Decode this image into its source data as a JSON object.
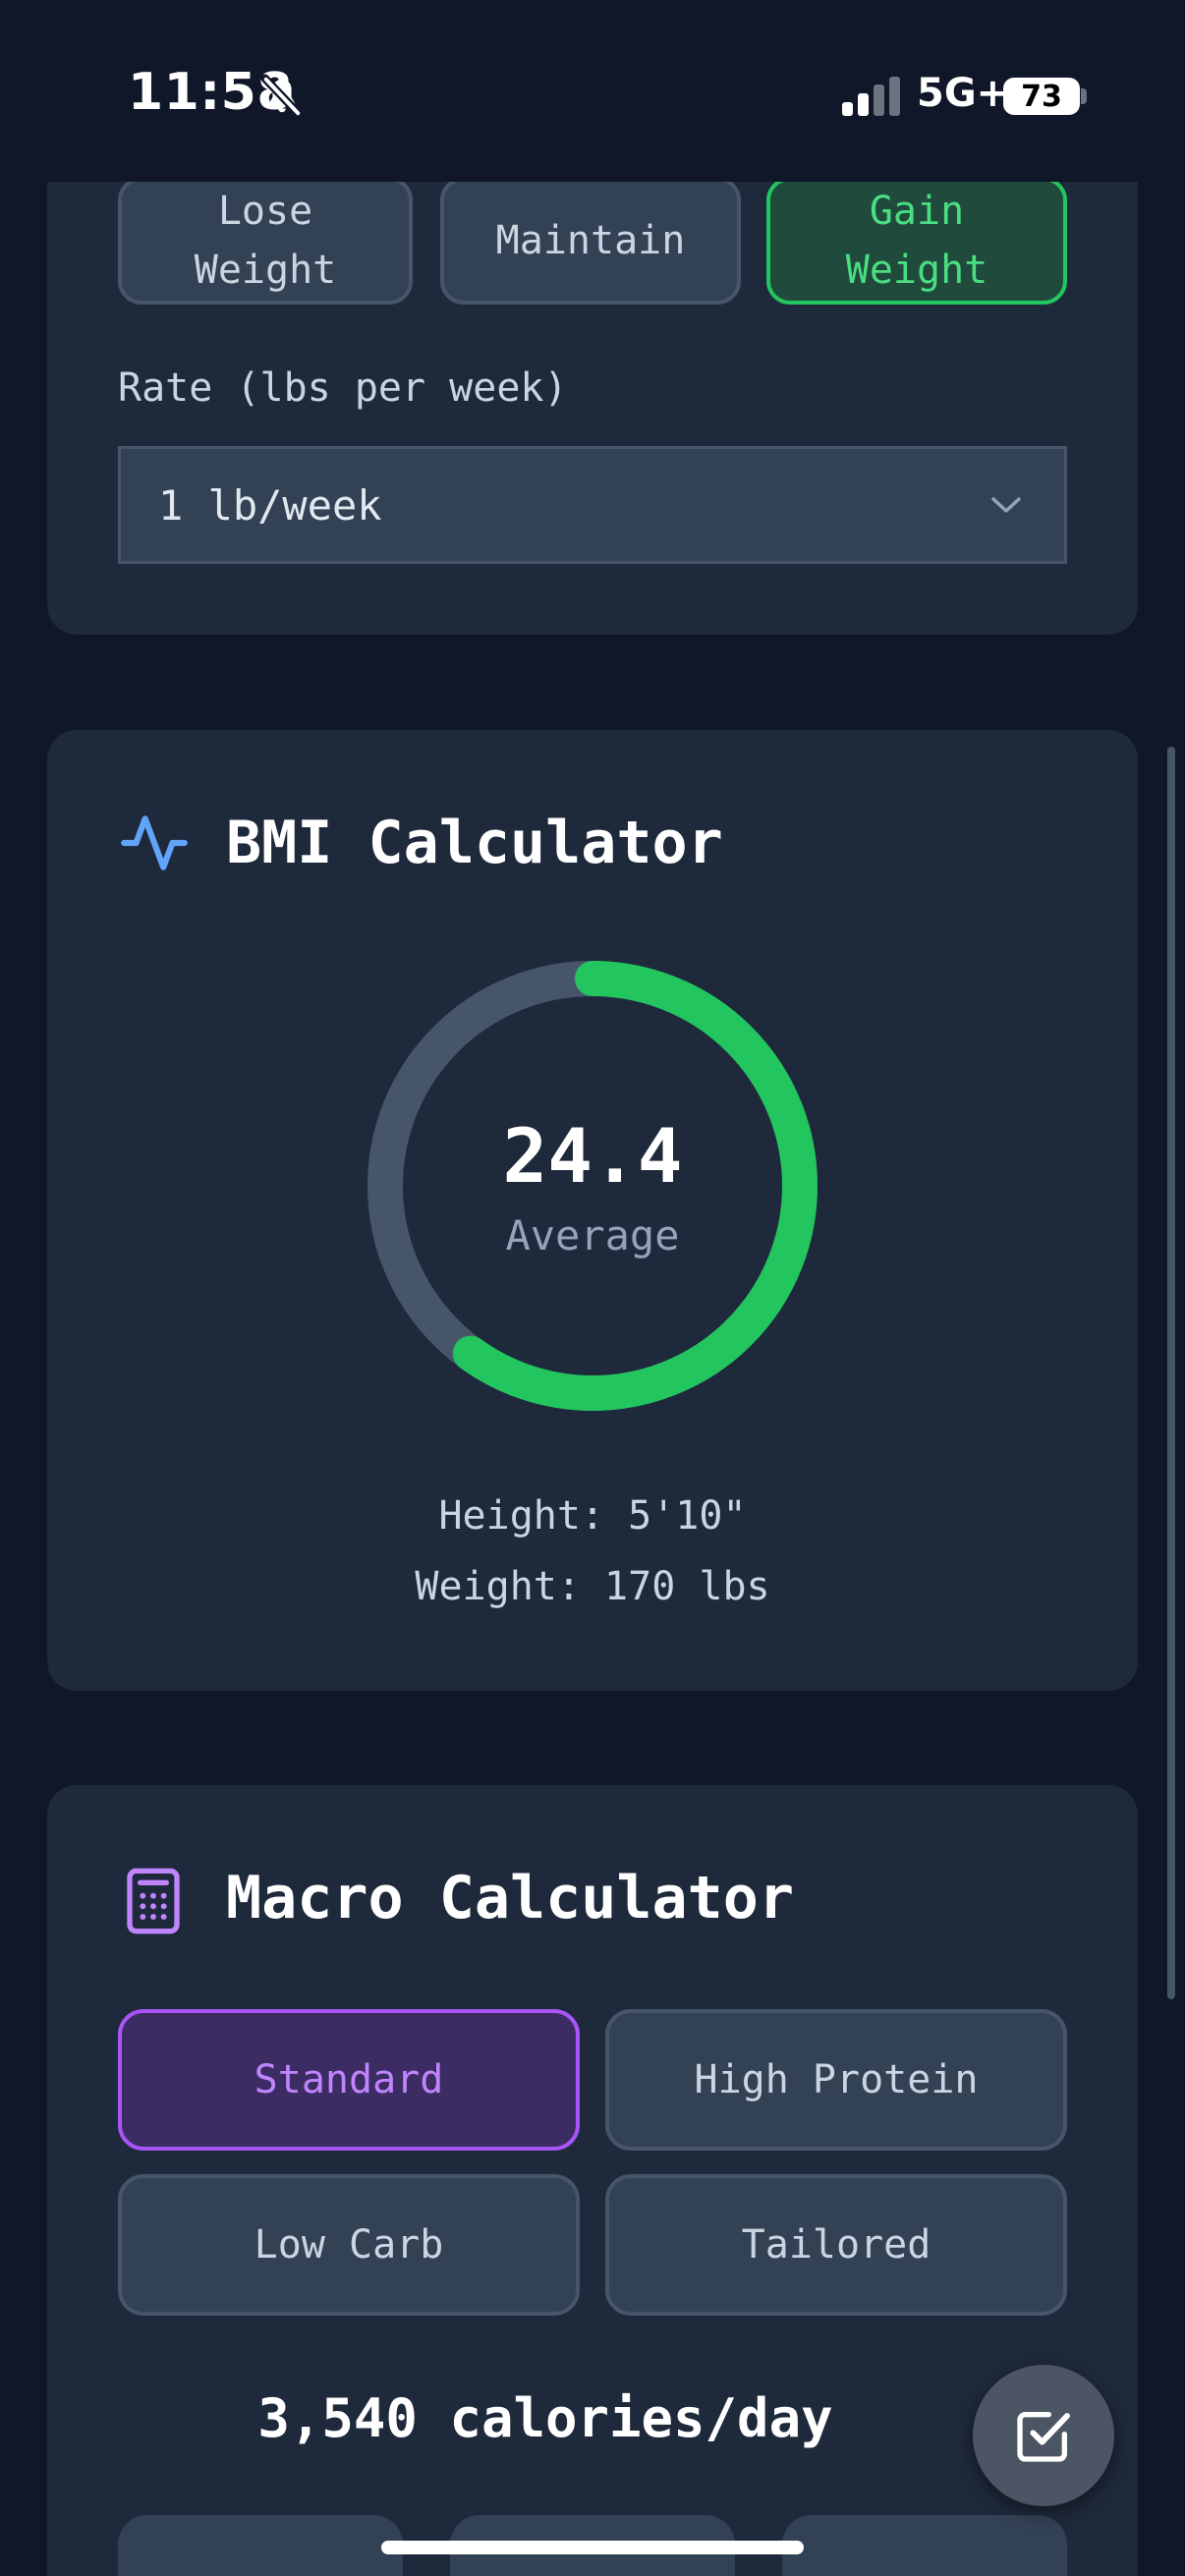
{
  "status_bar": {
    "time": "11:58",
    "network": "5G+",
    "battery": "73"
  },
  "goal": {
    "options": [
      {
        "label": "Lose\nWeight",
        "active": false
      },
      {
        "label": "Maintain",
        "active": false
      },
      {
        "label": "Gain\nWeight",
        "active": true
      }
    ],
    "rate_label": "Rate (lbs per week)",
    "rate_value": "1 lb/week"
  },
  "bmi": {
    "title": "BMI Calculator",
    "icon": "activity-icon",
    "value": "24.4",
    "category": "Average",
    "ring_fraction": 0.6,
    "height_text": "Height: 5'10\"",
    "weight_text": "Weight: 170 lbs"
  },
  "macro": {
    "title": "Macro Calculator",
    "icon": "calculator-icon",
    "presets": [
      {
        "label": "Standard",
        "active": true
      },
      {
        "label": "High Protein",
        "active": false
      },
      {
        "label": "Low Carb",
        "active": false
      },
      {
        "label": "Tailored",
        "active": false
      }
    ],
    "calories": "3,540 calories/day"
  },
  "fab": {
    "icon": "checkbox-edit-icon"
  },
  "colors": {
    "background": "#0f1729",
    "card": "#1e293b",
    "green_accent": "#22c55e",
    "purple_accent": "#a855f7",
    "blue_icon": "#60a5fa"
  }
}
